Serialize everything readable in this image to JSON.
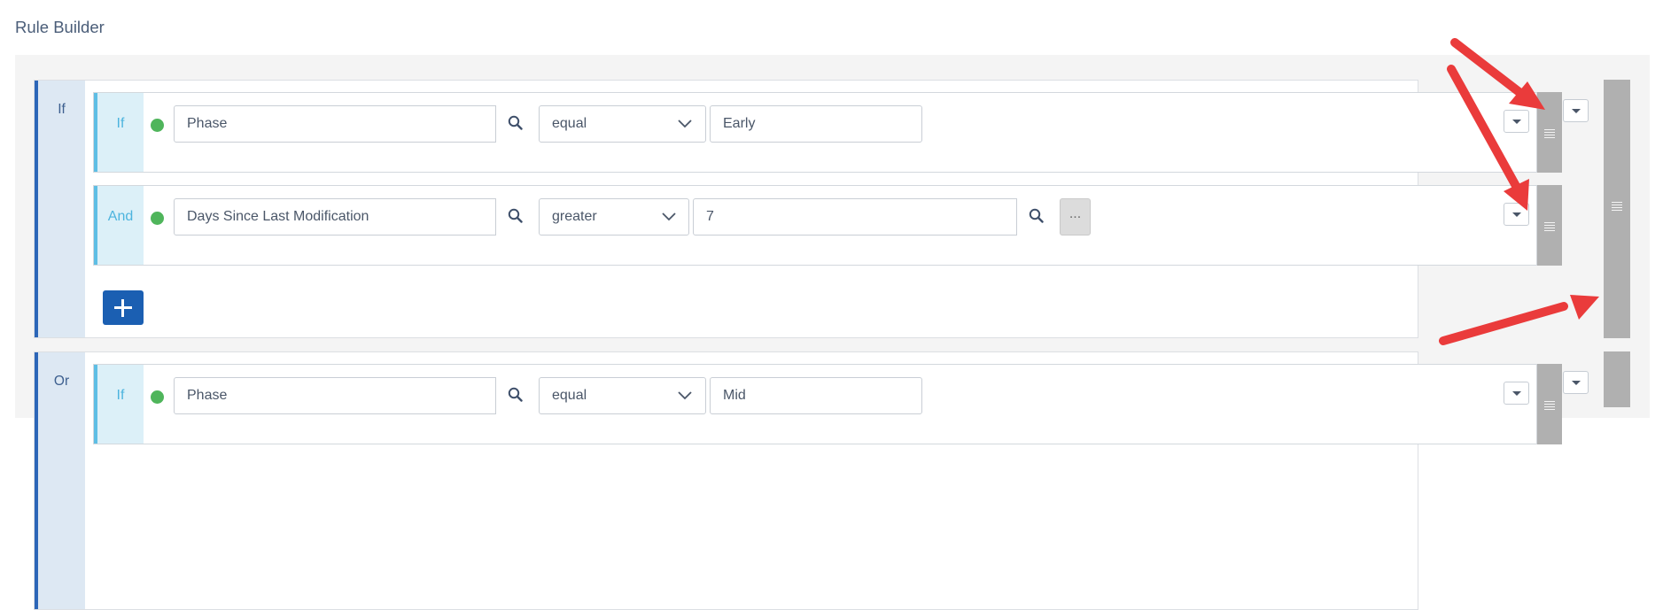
{
  "page": {
    "title": "Rule Builder"
  },
  "groups": [
    {
      "label": "If",
      "conditions": [
        {
          "label": "If",
          "field": "Phase",
          "operator": "equal",
          "value": "Early"
        },
        {
          "label": "And",
          "field": "Days Since Last Modification",
          "operator": "greater",
          "value": "7"
        }
      ]
    },
    {
      "label": "Or",
      "conditions": [
        {
          "label": "If",
          "field": "Phase",
          "operator": "equal",
          "value": "Mid"
        }
      ]
    }
  ],
  "icons": {
    "search": "search-icon",
    "dropdown": "chevron-down-icon",
    "caret": "caret-down-icon",
    "drag": "drag-handle-icon",
    "add": "plus-icon",
    "more": "ellipsis-icon"
  },
  "colors": {
    "group_accent": "#2c66b8",
    "condition_accent": "#5ebee4",
    "status_dot": "#4fb55b",
    "add_button": "#1b5fb2",
    "annotation_arrow": "#ea3b3b"
  },
  "more_button": {
    "label": "..."
  }
}
